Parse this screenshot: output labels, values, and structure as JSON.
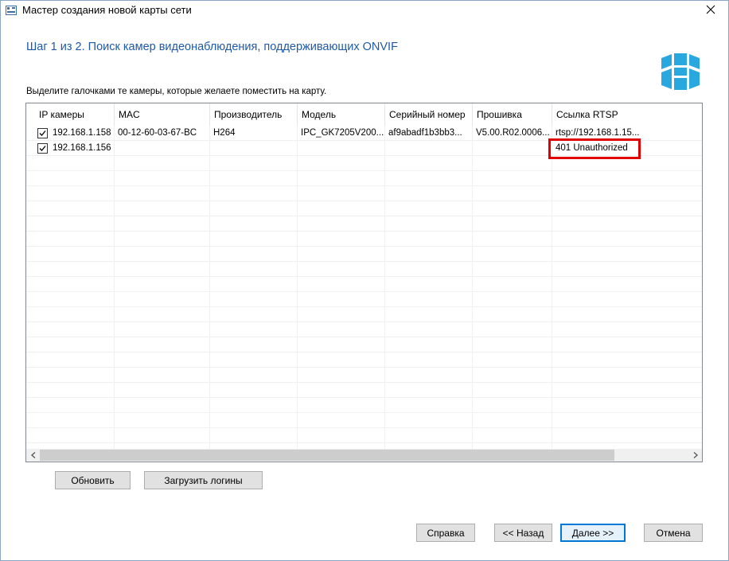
{
  "window": {
    "title": "Мастер создания новой карты сети",
    "step_title": "Шаг 1 из 2. Поиск камер видеонаблюдения, поддерживающих ONVIF",
    "instruction": "Выделите галочками те камеры, которые желаете поместить на карту."
  },
  "table": {
    "columns": [
      "IP камеры",
      "MAC",
      "Производитель",
      "Модель",
      "Серийный номер",
      "Прошивка",
      "Ссылка RTSP"
    ],
    "rows": [
      {
        "checked": true,
        "cells": [
          "192.168.1.158",
          "00-12-60-03-67-BC",
          "H264",
          "IPC_GK7205V200...",
          "af9abadf1b3bb3...",
          "V5.00.R02.0006...",
          "rtsp://192.168.1.15..."
        ]
      },
      {
        "checked": true,
        "cells": [
          "192.168.1.156",
          "",
          "",
          "",
          "",
          "",
          "401 Unauthorized"
        ]
      }
    ]
  },
  "buttons": {
    "refresh": "Обновить",
    "load_logins": "Загрузить логины",
    "help": "Справка",
    "back": "<< Назад",
    "next": "Далее >>",
    "cancel": "Отмена"
  },
  "colors": {
    "accent": "#1e5aa8",
    "logo": "#29a8e0",
    "error_highlight": "#e00000"
  },
  "icons": {
    "title": "network-map-icon",
    "close": "close-icon",
    "logo": "app-logo",
    "scroll_left": "chevron-left-icon",
    "scroll_right": "chevron-right-icon"
  }
}
